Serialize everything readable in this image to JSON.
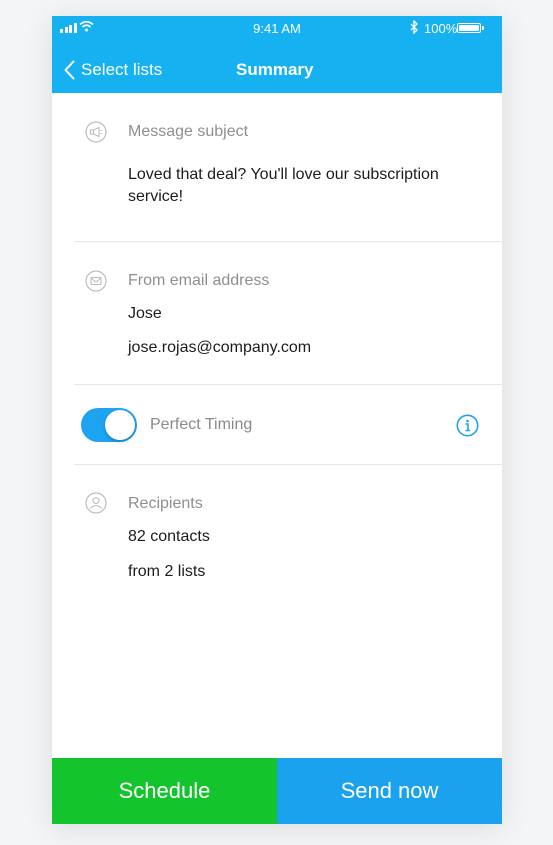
{
  "status_bar": {
    "time": "9:41 AM",
    "battery_percent": "100%",
    "icons": [
      "signal-icon",
      "wifi-icon",
      "bluetooth-icon",
      "battery-icon"
    ]
  },
  "nav": {
    "back_label": "Select lists",
    "title": "Summary"
  },
  "subject": {
    "label": "Message subject",
    "value": "Loved that deal? You'll love our subscription service!",
    "icon": "megaphone-icon"
  },
  "from": {
    "label": "From email address",
    "name": "Jose",
    "email": "jose.rojas@company.com",
    "icon": "envelope-icon"
  },
  "timing": {
    "label": "Perfect Timing",
    "enabled": true,
    "info_icon": "info-icon"
  },
  "recipients": {
    "label": "Recipients",
    "count": "82 contacts",
    "source": "from 2 lists",
    "icon": "person-icon"
  },
  "footer": {
    "schedule_label": "Schedule",
    "send_label": "Send now"
  },
  "colors": {
    "header": "#15b1f0",
    "toggle": "#1ea3f0",
    "schedule": "#14c42c",
    "send": "#1aa2ee"
  }
}
